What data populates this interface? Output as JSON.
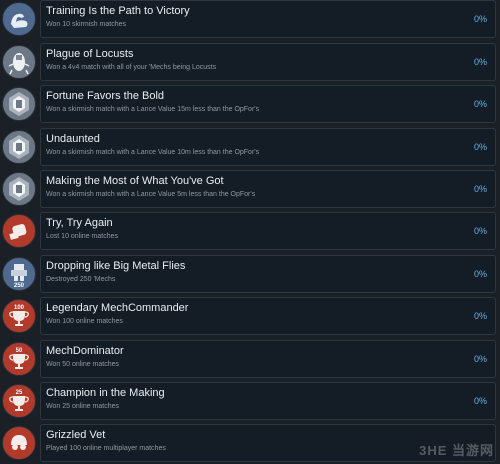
{
  "achievements": [
    {
      "title": "Training Is the Path to Victory",
      "desc": "Won 10 skirmish matches",
      "percent": "0%",
      "icon": "flexed-arm-icon",
      "badge": ""
    },
    {
      "title": "Plague of Locusts",
      "desc": "Won a 4v4 match with all of your 'Mechs being Locusts",
      "percent": "0%",
      "icon": "locust-icon",
      "badge": ""
    },
    {
      "title": "Fortune Favors the Bold",
      "desc": "Won a skirmish match with a Lance Value 15m less than the OpFor's",
      "percent": "0%",
      "icon": "mech-emblem-icon",
      "badge": ""
    },
    {
      "title": "Undaunted",
      "desc": "Won a skirmish match with a Lance Value 10m less than the OpFor's",
      "percent": "0%",
      "icon": "mech-emblem-icon",
      "badge": ""
    },
    {
      "title": "Making the Most of What You've Got",
      "desc": "Won a skirmish match with a Lance Value 5m less than the OpFor's",
      "percent": "0%",
      "icon": "mech-emblem-icon",
      "badge": ""
    },
    {
      "title": "Try, Try Again",
      "desc": "Lost 10 online matches",
      "percent": "0%",
      "icon": "fist-icon",
      "badge": ""
    },
    {
      "title": "Dropping like Big Metal Flies",
      "desc": "Destroyed 250 'Mechs",
      "percent": "0%",
      "icon": "mech-250-icon",
      "badge": "250"
    },
    {
      "title": "Legendary MechCommander",
      "desc": "Won 100 online matches",
      "percent": "0%",
      "icon": "trophy-icon",
      "badge": "100"
    },
    {
      "title": "MechDominator",
      "desc": "Won 50 online matches",
      "percent": "0%",
      "icon": "trophy-icon",
      "badge": "50"
    },
    {
      "title": "Champion in the Making",
      "desc": "Won 25 online matches",
      "percent": "0%",
      "icon": "trophy-icon",
      "badge": "25"
    },
    {
      "title": "Grizzled Vet",
      "desc": "Played 100 online multiplayer matches",
      "percent": "",
      "icon": "helmet-icon",
      "badge": ""
    }
  ],
  "watermark": "3HE 当游网",
  "colors": {
    "blue_icon": "#4f6a8e",
    "grey_icon": "#6c7885",
    "red_icon": "#b23a2b",
    "percent": "#66b4e8"
  }
}
